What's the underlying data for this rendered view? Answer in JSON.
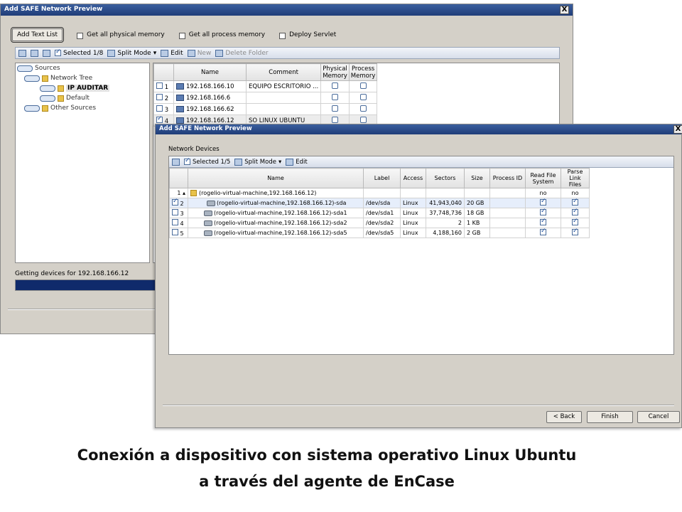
{
  "back_dialog": {
    "title": "Add SAFE Network Preview",
    "close": "X",
    "add_text_list": "Add Text List",
    "options": [
      "Get all physical memory",
      "Get all process memory",
      "Deploy Servlet"
    ],
    "toolbar": {
      "selected": "Selected 1/8",
      "split_mode": "Split Mode",
      "edit": "Edit",
      "new": "New",
      "delete_folder": "Delete Folder"
    },
    "tree": {
      "sources": "Sources",
      "network_tree": "Network Tree",
      "ip_auditar": "IP AUDITAR",
      "default": "Default",
      "other_sources": "Other Sources"
    },
    "columns": [
      "Name",
      "Comment",
      "Physical Memory",
      "Process Memory"
    ],
    "rows": [
      {
        "num": "1",
        "name": "192.168.166.10",
        "comment": "EQUIPO ESCRITORIO ...",
        "checked": false
      },
      {
        "num": "2",
        "name": "192.168.166.6",
        "comment": "",
        "checked": false
      },
      {
        "num": "3",
        "name": "192.168.166.62",
        "comment": "",
        "checked": false
      },
      {
        "num": "4",
        "name": "192.168.166.12",
        "comment": "SO LINUX UBUNTU",
        "checked": true
      }
    ],
    "status": "Getting devices for 192.168.166.12"
  },
  "front_dialog": {
    "title": "Add SAFE Network Preview",
    "close": "X",
    "group_label": "Network Devices",
    "toolbar": {
      "selected": "Selected 1/5",
      "split_mode": "Split Mode",
      "edit": "Edit"
    },
    "columns": [
      "Name",
      "Label",
      "Access",
      "Sectors",
      "Size",
      "Process ID",
      "Read File System",
      "Parse Link Files"
    ],
    "rows": [
      {
        "num": "1",
        "name": "(rogelio-virtual-machine,192.168.166.12)",
        "label": "",
        "access": "",
        "sectors": "",
        "size": "",
        "pid": "",
        "read": "no",
        "parse": "no",
        "checked": false
      },
      {
        "num": "2",
        "name": "(rogelio-virtual-machine,192.168.166.12)-sda",
        "label": "/dev/sda",
        "access": "Linux",
        "sectors": "41,943,040",
        "size": "20 GB",
        "pid": "",
        "read": "",
        "parse": "",
        "checked": true
      },
      {
        "num": "3",
        "name": "(rogelio-virtual-machine,192.168.166.12)-sda1",
        "label": "/dev/sda1",
        "access": "Linux",
        "sectors": "37,748,736",
        "size": "18 GB",
        "pid": "",
        "read": "",
        "parse": "",
        "checked": false
      },
      {
        "num": "4",
        "name": "(rogelio-virtual-machine,192.168.166.12)-sda2",
        "label": "/dev/sda2",
        "access": "Linux",
        "sectors": "2",
        "size": "1 KB",
        "pid": "",
        "read": "",
        "parse": "",
        "checked": false
      },
      {
        "num": "5",
        "name": "(rogelio-virtual-machine,192.168.166.12)-sda5",
        "label": "/dev/sda5",
        "access": "Linux",
        "sectors": "4,188,160",
        "size": "2 GB",
        "pid": "",
        "read": "",
        "parse": "",
        "checked": false
      }
    ],
    "buttons": {
      "back": "< Back",
      "finish": "Finish",
      "cancel": "Cancel"
    }
  },
  "caption": {
    "line1": "Conexión a dispositivo con sistema operativo Linux Ubuntu",
    "line2": "a través del agente de EnCase"
  }
}
